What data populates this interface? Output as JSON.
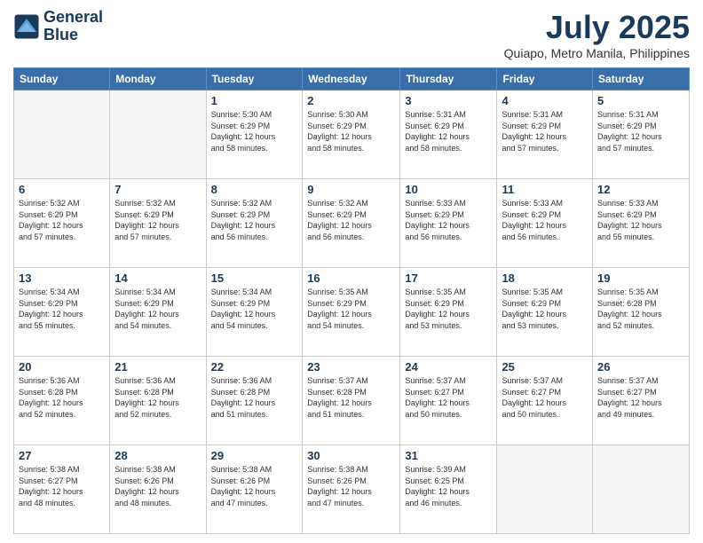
{
  "header": {
    "logo_line1": "General",
    "logo_line2": "Blue",
    "month": "July 2025",
    "location": "Quiapo, Metro Manila, Philippines"
  },
  "weekdays": [
    "Sunday",
    "Monday",
    "Tuesday",
    "Wednesday",
    "Thursday",
    "Friday",
    "Saturday"
  ],
  "weeks": [
    [
      {
        "day": "",
        "info": ""
      },
      {
        "day": "",
        "info": ""
      },
      {
        "day": "1",
        "info": "Sunrise: 5:30 AM\nSunset: 6:29 PM\nDaylight: 12 hours\nand 58 minutes."
      },
      {
        "day": "2",
        "info": "Sunrise: 5:30 AM\nSunset: 6:29 PM\nDaylight: 12 hours\nand 58 minutes."
      },
      {
        "day": "3",
        "info": "Sunrise: 5:31 AM\nSunset: 6:29 PM\nDaylight: 12 hours\nand 58 minutes."
      },
      {
        "day": "4",
        "info": "Sunrise: 5:31 AM\nSunset: 6:29 PM\nDaylight: 12 hours\nand 57 minutes."
      },
      {
        "day": "5",
        "info": "Sunrise: 5:31 AM\nSunset: 6:29 PM\nDaylight: 12 hours\nand 57 minutes."
      }
    ],
    [
      {
        "day": "6",
        "info": "Sunrise: 5:32 AM\nSunset: 6:29 PM\nDaylight: 12 hours\nand 57 minutes."
      },
      {
        "day": "7",
        "info": "Sunrise: 5:32 AM\nSunset: 6:29 PM\nDaylight: 12 hours\nand 57 minutes."
      },
      {
        "day": "8",
        "info": "Sunrise: 5:32 AM\nSunset: 6:29 PM\nDaylight: 12 hours\nand 56 minutes."
      },
      {
        "day": "9",
        "info": "Sunrise: 5:32 AM\nSunset: 6:29 PM\nDaylight: 12 hours\nand 56 minutes."
      },
      {
        "day": "10",
        "info": "Sunrise: 5:33 AM\nSunset: 6:29 PM\nDaylight: 12 hours\nand 56 minutes."
      },
      {
        "day": "11",
        "info": "Sunrise: 5:33 AM\nSunset: 6:29 PM\nDaylight: 12 hours\nand 56 minutes."
      },
      {
        "day": "12",
        "info": "Sunrise: 5:33 AM\nSunset: 6:29 PM\nDaylight: 12 hours\nand 55 minutes."
      }
    ],
    [
      {
        "day": "13",
        "info": "Sunrise: 5:34 AM\nSunset: 6:29 PM\nDaylight: 12 hours\nand 55 minutes."
      },
      {
        "day": "14",
        "info": "Sunrise: 5:34 AM\nSunset: 6:29 PM\nDaylight: 12 hours\nand 54 minutes."
      },
      {
        "day": "15",
        "info": "Sunrise: 5:34 AM\nSunset: 6:29 PM\nDaylight: 12 hours\nand 54 minutes."
      },
      {
        "day": "16",
        "info": "Sunrise: 5:35 AM\nSunset: 6:29 PM\nDaylight: 12 hours\nand 54 minutes."
      },
      {
        "day": "17",
        "info": "Sunrise: 5:35 AM\nSunset: 6:29 PM\nDaylight: 12 hours\nand 53 minutes."
      },
      {
        "day": "18",
        "info": "Sunrise: 5:35 AM\nSunset: 6:29 PM\nDaylight: 12 hours\nand 53 minutes."
      },
      {
        "day": "19",
        "info": "Sunrise: 5:35 AM\nSunset: 6:28 PM\nDaylight: 12 hours\nand 52 minutes."
      }
    ],
    [
      {
        "day": "20",
        "info": "Sunrise: 5:36 AM\nSunset: 6:28 PM\nDaylight: 12 hours\nand 52 minutes."
      },
      {
        "day": "21",
        "info": "Sunrise: 5:36 AM\nSunset: 6:28 PM\nDaylight: 12 hours\nand 52 minutes."
      },
      {
        "day": "22",
        "info": "Sunrise: 5:36 AM\nSunset: 6:28 PM\nDaylight: 12 hours\nand 51 minutes."
      },
      {
        "day": "23",
        "info": "Sunrise: 5:37 AM\nSunset: 6:28 PM\nDaylight: 12 hours\nand 51 minutes."
      },
      {
        "day": "24",
        "info": "Sunrise: 5:37 AM\nSunset: 6:27 PM\nDaylight: 12 hours\nand 50 minutes."
      },
      {
        "day": "25",
        "info": "Sunrise: 5:37 AM\nSunset: 6:27 PM\nDaylight: 12 hours\nand 50 minutes."
      },
      {
        "day": "26",
        "info": "Sunrise: 5:37 AM\nSunset: 6:27 PM\nDaylight: 12 hours\nand 49 minutes."
      }
    ],
    [
      {
        "day": "27",
        "info": "Sunrise: 5:38 AM\nSunset: 6:27 PM\nDaylight: 12 hours\nand 48 minutes."
      },
      {
        "day": "28",
        "info": "Sunrise: 5:38 AM\nSunset: 6:26 PM\nDaylight: 12 hours\nand 48 minutes."
      },
      {
        "day": "29",
        "info": "Sunrise: 5:38 AM\nSunset: 6:26 PM\nDaylight: 12 hours\nand 47 minutes."
      },
      {
        "day": "30",
        "info": "Sunrise: 5:38 AM\nSunset: 6:26 PM\nDaylight: 12 hours\nand 47 minutes."
      },
      {
        "day": "31",
        "info": "Sunrise: 5:39 AM\nSunset: 6:25 PM\nDaylight: 12 hours\nand 46 minutes."
      },
      {
        "day": "",
        "info": ""
      },
      {
        "day": "",
        "info": ""
      }
    ]
  ]
}
